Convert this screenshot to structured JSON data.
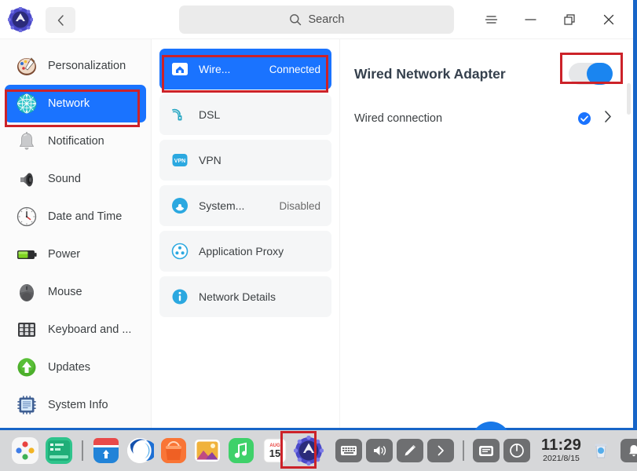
{
  "window": {
    "app_logo_icon": "settings-gear-logo",
    "back_button_icon": "chevron-left-icon",
    "search": {
      "icon": "search-icon",
      "label": "Search"
    },
    "controls": {
      "menu_icon": "hamburger-menu-icon",
      "minimize_icon": "minimize-icon",
      "maximize_icon": "restore-window-icon",
      "close_icon": "close-icon"
    }
  },
  "sidebar": {
    "items": [
      {
        "label": "Personalization",
        "icon": "paint-palette-icon",
        "active": false
      },
      {
        "label": "Network",
        "icon": "network-globe-icon",
        "active": true
      },
      {
        "label": "Notification",
        "icon": "bell-icon",
        "active": false
      },
      {
        "label": "Sound",
        "icon": "speaker-icon",
        "active": false
      },
      {
        "label": "Date and Time",
        "icon": "clock-icon",
        "active": false
      },
      {
        "label": "Power",
        "icon": "battery-icon",
        "active": false
      },
      {
        "label": "Mouse",
        "icon": "mouse-icon",
        "active": false
      },
      {
        "label": "Keyboard and ...",
        "icon": "keyboard-icon",
        "active": false
      },
      {
        "label": "Updates",
        "icon": "up-arrow-circle-icon",
        "active": false
      },
      {
        "label": "System Info",
        "icon": "chip-document-icon",
        "active": false
      }
    ]
  },
  "network_list": {
    "items": [
      {
        "name": "Wire...",
        "status": "Connected",
        "icon": "wired-adapter-icon",
        "selected": true
      },
      {
        "name": "DSL",
        "status": "",
        "icon": "dsl-icon",
        "selected": false
      },
      {
        "name": "VPN",
        "status": "",
        "icon": "vpn-icon",
        "selected": false
      },
      {
        "name": "System...",
        "status": "Disabled",
        "icon": "system-proxy-icon",
        "selected": false
      },
      {
        "name": "Application Proxy",
        "status": "",
        "icon": "application-proxy-icon",
        "selected": false
      },
      {
        "name": "Network Details",
        "status": "",
        "icon": "info-icon",
        "selected": false
      }
    ]
  },
  "detail": {
    "title": "Wired Network Adapter",
    "toggle_state": "on",
    "connection": {
      "name": "Wired connection",
      "check_icon": "check-circle-icon",
      "chevron_icon": "chevron-right-icon"
    },
    "fab_icon": "add-circle-button"
  },
  "taskbar": {
    "apps": [
      {
        "icon": "app-launcher-icon",
        "active": false
      },
      {
        "icon": "terminal-icon",
        "active": false
      },
      {
        "icon": "app-store-icon",
        "active": false
      },
      {
        "icon": "browser-icon",
        "active": false
      },
      {
        "icon": "file-manager-icon",
        "active": false
      },
      {
        "icon": "photos-icon",
        "active": false
      },
      {
        "icon": "music-icon",
        "active": false
      },
      {
        "icon": "calendar-icon",
        "active": false
      },
      {
        "icon": "control-center-settings-icon",
        "active": true
      }
    ],
    "calendar": {
      "month": "AUG",
      "day": "15"
    },
    "tray": [
      {
        "icon": "keyboard-tray-icon"
      },
      {
        "icon": "volume-tray-icon"
      },
      {
        "icon": "brightness-pen-tray-icon"
      },
      {
        "icon": "expand-tray-icon"
      }
    ],
    "tray2": [
      {
        "icon": "display-tray-icon"
      },
      {
        "icon": "power-tray-icon"
      }
    ],
    "clock": {
      "time": "11:29",
      "date": "2021/8/15"
    },
    "trash_icon": "trash-icon",
    "notification_icon": "bell-tray-icon"
  },
  "colors": {
    "accent": "#1a73ff",
    "toggle_on": "#1a85f0",
    "highlight_box": "#cc2229",
    "desktop": "#1765c8",
    "taskbar": "#d6d7d9"
  }
}
